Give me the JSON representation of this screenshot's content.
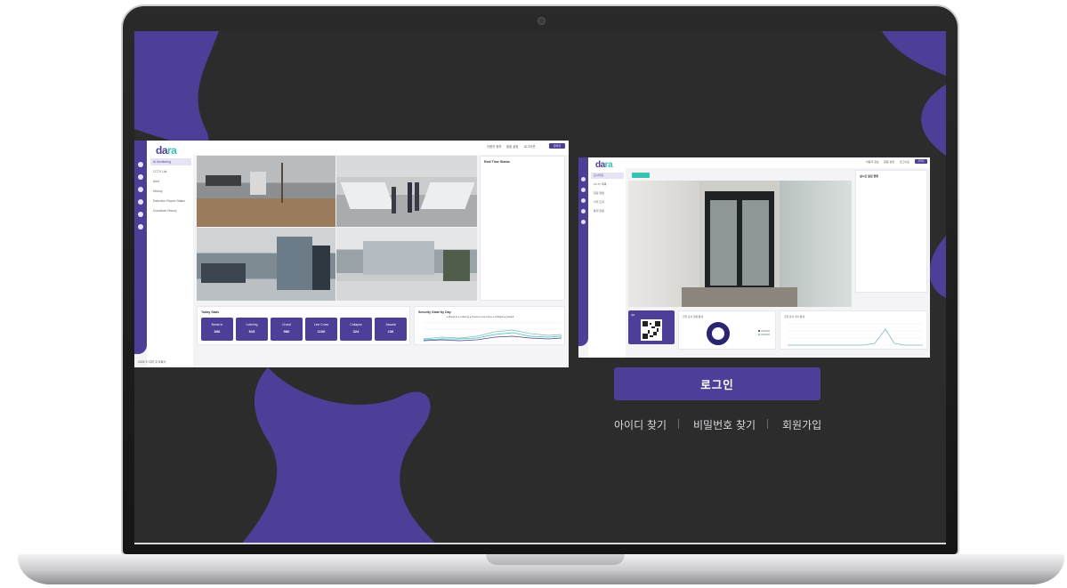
{
  "dashboard": {
    "logo": {
      "main": "da",
      "accent": "ra"
    },
    "menu": [
      "AI Monitoring",
      "CCTV List",
      "Alert",
      "History",
      "Detection Report Status",
      "Download History"
    ],
    "top_links": [
      "이용자 정보",
      "알림 설정",
      "로그아웃"
    ],
    "top_button": "관리자",
    "realtime_title": "Real Time Status",
    "stats_title": "Today Stats",
    "stats": [
      {
        "label": "Break In",
        "value": "836"
      },
      {
        "label": "Loitering",
        "value": "515"
      },
      {
        "label": "Crowd",
        "value": "580"
      },
      {
        "label": "Line Cross",
        "value": "1100"
      },
      {
        "label": "Collapse",
        "value": "324"
      },
      {
        "label": "Assault",
        "value": "136"
      }
    ],
    "chart_title": "Security State by Day",
    "legend": "● Break In  ● Loitering  ● Crowd  ● Line Cross  ● Collapse  ● Assault",
    "footer": "2024 © 다라 주식회사"
  },
  "detail": {
    "logo": {
      "main": "da",
      "accent": "ra"
    },
    "menu": [
      "모니터링",
      "CCTV 목록",
      "알림 현황",
      "이력 조회",
      "통계 현황"
    ],
    "top_links": [
      "이용자 정보",
      "알림 설정",
      "로그아웃"
    ],
    "top_button": "관리자",
    "realtime_title": "실시간 알림 현황",
    "qr_label": "QR",
    "donut_title": "금일 감지 현황 통계",
    "trend_title": "금일 감지 추이 통계"
  },
  "login": {
    "button_label": "로그인",
    "find_id": "아이디 찾기",
    "find_password": "비밀번호 찾기",
    "sign_up": "회원가입"
  },
  "colors": {
    "brand_purple": "#4d3f97",
    "accent_teal": "#39c2b2",
    "screen_bg": "#2c2c2c"
  }
}
